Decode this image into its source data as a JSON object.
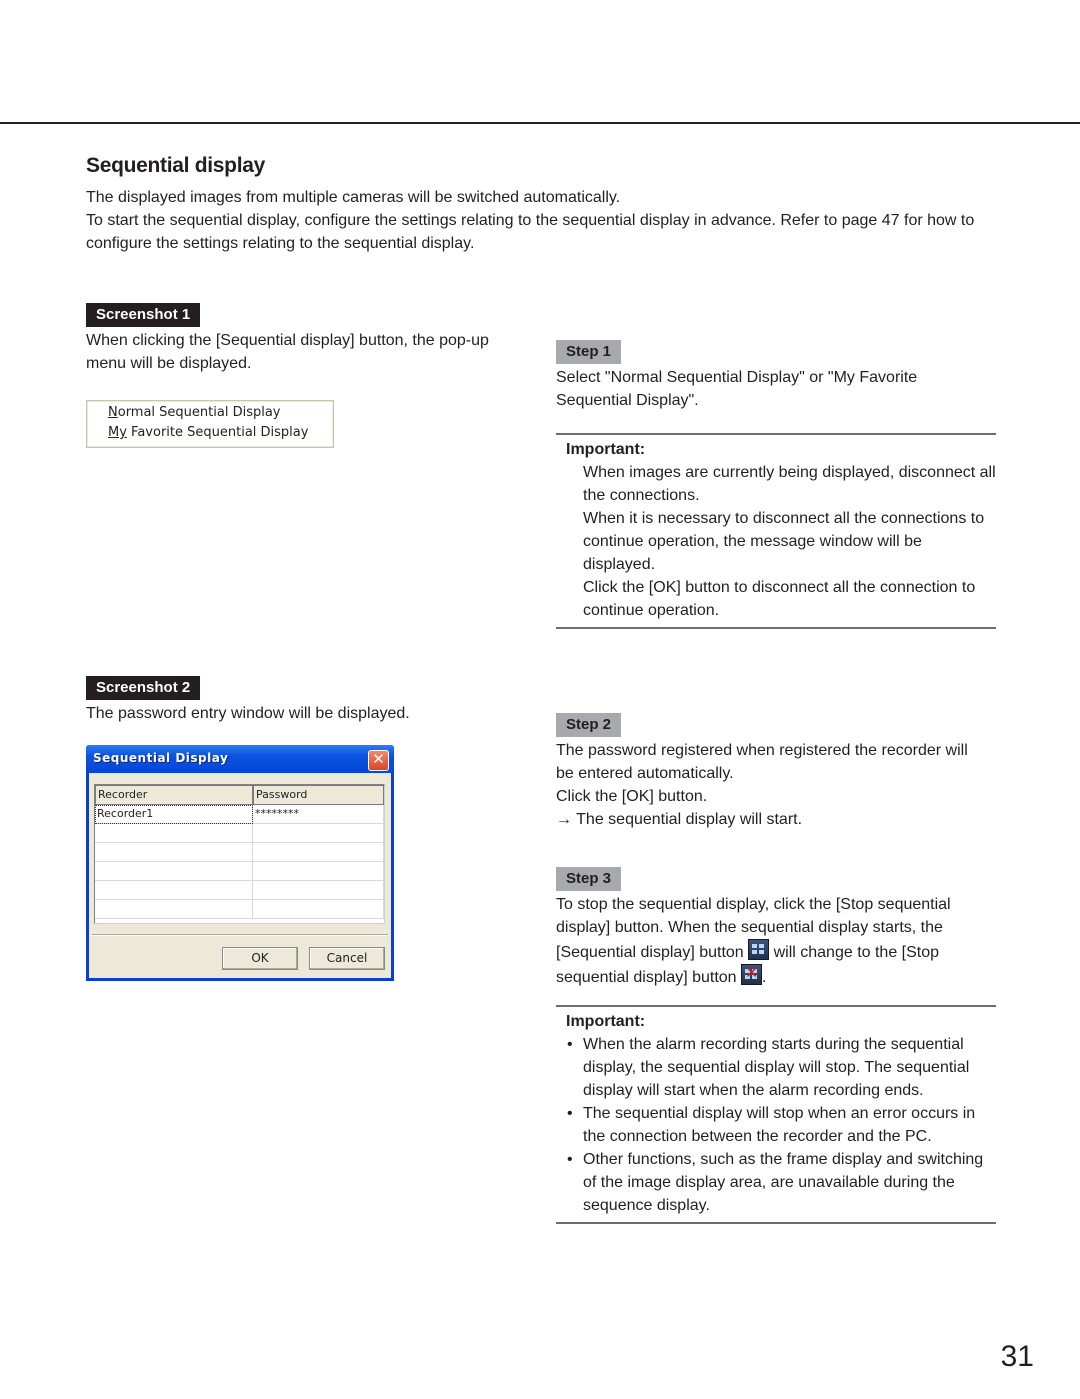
{
  "section": {
    "title": "Sequential display",
    "intro": [
      "The displayed images from multiple cameras will be switched automatically.",
      "To start the sequential display, configure the settings relating to the sequential display in advance. Refer to page 47 for how to configure the settings relating to the sequential display."
    ]
  },
  "screenshot1": {
    "label": "Screenshot 1",
    "caption": "When clicking the [Sequential display] button, the pop-up menu will be displayed.",
    "popup_menu": {
      "items": [
        {
          "mnemonic": "N",
          "rest": "ormal Sequential Display"
        },
        {
          "mnemonic": "My",
          "rest": " Favorite Sequential Display"
        }
      ]
    }
  },
  "screenshot2": {
    "label": "Screenshot 2",
    "caption": "The password entry window will be displayed.",
    "dialog": {
      "title": "Sequential Display",
      "close_icon": "close-x-icon",
      "columns": [
        "Recorder",
        "Password"
      ],
      "rows": [
        [
          "Recorder1",
          "********"
        ],
        [
          "",
          ""
        ],
        [
          "",
          ""
        ],
        [
          "",
          ""
        ],
        [
          "",
          ""
        ],
        [
          "",
          ""
        ]
      ],
      "ok_label": "OK",
      "cancel_label": "Cancel"
    }
  },
  "step1": {
    "label": "Step 1",
    "text": "Select \"Normal Sequential Display\" or \"My Favorite Sequential Display\".",
    "important": {
      "label": "Important:",
      "paragraphs": [
        "When images are currently being displayed, disconnect all the connections.",
        "When it is necessary to disconnect all the connections to continue operation, the message window will be displayed.",
        "Click the [OK] button to disconnect all the connection to continue operation."
      ]
    }
  },
  "step2": {
    "label": "Step 2",
    "lines": [
      "The password registered when registered the recorder will be entered automatically.",
      "Click the [OK] button.",
      "→ The sequential display will start."
    ]
  },
  "step3": {
    "label": "Step 3",
    "text_a": "To stop the sequential display, click the [Stop sequential display] button. When the sequential display starts, the [Sequential display] button",
    "icon_a": "sequential-display-icon",
    "text_b": "will change to the [Stop sequential display] button",
    "icon_b": "stop-sequential-display-icon",
    "text_c": ".",
    "important": {
      "label": "Important:",
      "bullets": [
        "When the alarm recording starts during the sequential display, the sequential display will stop. The sequential display will start when the alarm recording ends.",
        "The sequential display will stop when an error occurs in the connection between the recorder and the PC.",
        "Other functions, such as the frame display and switching of the image display area, are unavailable during the sequence display."
      ]
    }
  },
  "page_number": "31"
}
